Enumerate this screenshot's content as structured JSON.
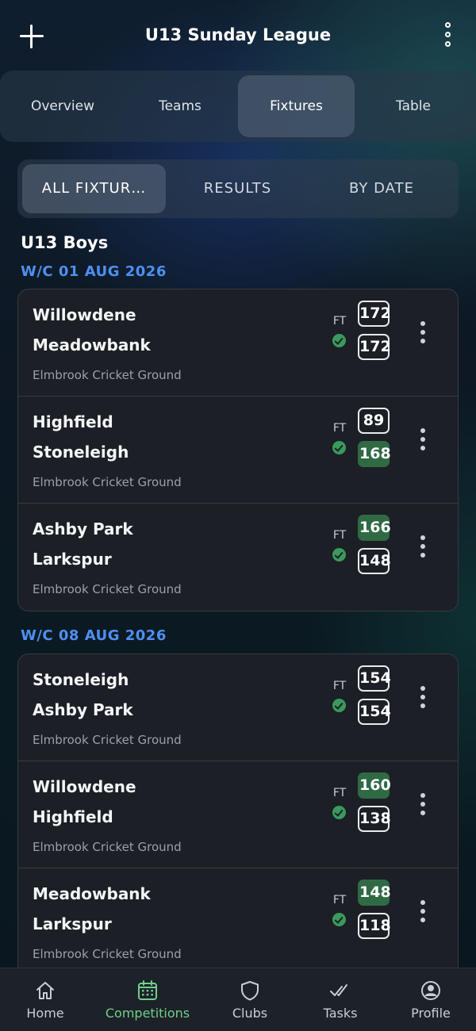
{
  "header": {
    "title": "U13 Sunday League"
  },
  "main_tabs": [
    {
      "label": "Overview"
    },
    {
      "label": "Teams"
    },
    {
      "label": "Fixtures"
    },
    {
      "label": "Table"
    }
  ],
  "active_main_tab": "Fixtures",
  "sub_tabs": [
    {
      "label": "ALL FIXTUR…"
    },
    {
      "label": "RESULTS"
    },
    {
      "label": "BY DATE"
    }
  ],
  "active_sub_tab": "ALL FIXTUR…",
  "group": {
    "title": "U13 Boys"
  },
  "weeks": [
    {
      "label": "W/C 01 AUG 2026",
      "fixtures": [
        {
          "home": "Willowdene",
          "away": "Meadowbank",
          "home_score": "172",
          "away_score": "172",
          "status": "FT",
          "venue": "Elmbrook Cricket Ground"
        },
        {
          "home": "Highfield",
          "away": "Stoneleigh",
          "home_score": "89",
          "away_score": "168",
          "status": "FT",
          "venue": "Elmbrook Cricket Ground"
        },
        {
          "home": "Ashby Park",
          "away": "Larkspur",
          "home_score": "166",
          "away_score": "148",
          "status": "FT",
          "venue": "Elmbrook Cricket Ground"
        }
      ]
    },
    {
      "label": "W/C 08 AUG 2026",
      "fixtures": [
        {
          "home": "Stoneleigh",
          "away": "Ashby Park",
          "home_score": "154",
          "away_score": "154",
          "status": "FT",
          "venue": "Elmbrook Cricket Ground"
        },
        {
          "home": "Willowdene",
          "away": "Highfield",
          "home_score": "160",
          "away_score": "138",
          "status": "FT",
          "venue": "Elmbrook Cricket Ground"
        },
        {
          "home": "Meadowbank",
          "away": "Larkspur",
          "home_score": "148",
          "away_score": "118",
          "status": "FT",
          "venue": "Elmbrook Cricket Ground"
        }
      ]
    }
  ],
  "bottom_nav": [
    {
      "label": "Home",
      "icon": "home-icon"
    },
    {
      "label": "Competitions",
      "icon": "calendar-icon"
    },
    {
      "label": "Clubs",
      "icon": "shield-icon"
    },
    {
      "label": "Tasks",
      "icon": "double-check-icon"
    },
    {
      "label": "Profile",
      "icon": "user-circle-icon"
    }
  ],
  "active_nav": "Competitions",
  "colors": {
    "accent": "#6fd08a",
    "week_heading": "#4f8ff0",
    "win_score": "#2f6a45",
    "card_bg": "#1c1f25"
  }
}
